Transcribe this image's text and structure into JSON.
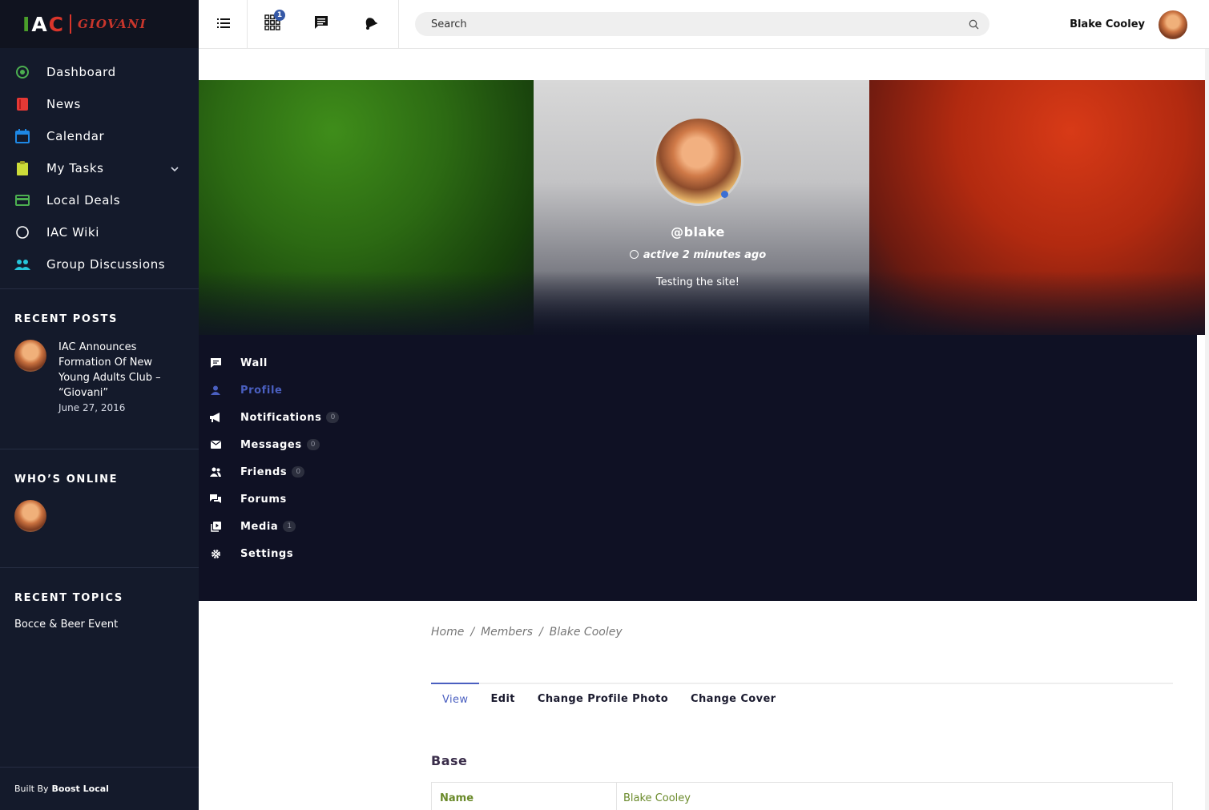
{
  "brand": {
    "iac_i": "I",
    "iac_a": "A",
    "iac_c": "C",
    "giovani": "GIOVANI"
  },
  "sidebar": {
    "items": [
      {
        "label": "Dashboard",
        "icon": "dashboard-icon",
        "color": "#4caf50"
      },
      {
        "label": "News",
        "icon": "news-icon",
        "color": "#e53935"
      },
      {
        "label": "Calendar",
        "icon": "calendar-icon",
        "color": "#1e88e5"
      },
      {
        "label": "My Tasks",
        "icon": "clipboard-icon",
        "color": "#cddc39"
      },
      {
        "label": "Local Deals",
        "icon": "card-icon",
        "color": "#4caf50"
      },
      {
        "label": "IAC Wiki",
        "icon": "circle-icon",
        "color": "#ffffff"
      },
      {
        "label": "Group Discussions",
        "icon": "group-icon",
        "color": "#26c6da"
      }
    ],
    "recent_posts_title": "RECENT POSTS",
    "recent_post": {
      "title": "IAC Announces Formation Of New Young Adults Club – “Giovani”",
      "date": "June 27, 2016"
    },
    "whos_online_title": "WHO’S ONLINE",
    "recent_topics_title": "RECENT TOPICS",
    "recent_topic": "Bocce & Beer Event",
    "footer_prefix": "Built By",
    "footer_brand": "Boost Local"
  },
  "topbar": {
    "notification_badge": "1",
    "search_placeholder": "Search",
    "user_name": "Blake Cooley"
  },
  "profile": {
    "handle": "@blake",
    "active": "active 2 minutes ago",
    "status": "Testing the site!"
  },
  "profile_nav": [
    {
      "label": "Wall",
      "icon": "wall-icon"
    },
    {
      "label": "Profile",
      "icon": "person-icon",
      "current": true
    },
    {
      "label": "Notifications",
      "icon": "megaphone-icon",
      "count": "0"
    },
    {
      "label": "Messages",
      "icon": "envelope-icon",
      "count": "0"
    },
    {
      "label": "Friends",
      "icon": "friends-icon",
      "count": "0"
    },
    {
      "label": "Forums",
      "icon": "forums-icon"
    },
    {
      "label": "Media",
      "icon": "media-icon",
      "count": "1"
    },
    {
      "label": "Settings",
      "icon": "gear-icon"
    }
  ],
  "breadcrumb": {
    "home": "Home",
    "members": "Members",
    "current": "Blake Cooley",
    "separator": "/"
  },
  "tabs": [
    "View",
    "Edit",
    "Change Profile Photo",
    "Change Cover"
  ],
  "section": {
    "title": "Base",
    "fields": [
      {
        "key": "Name",
        "value": "Blake Cooley"
      }
    ]
  },
  "colors": {
    "sidebar_bg": "#141a2b",
    "accent": "#4a5fc0",
    "field_green": "#6a8a2a"
  }
}
